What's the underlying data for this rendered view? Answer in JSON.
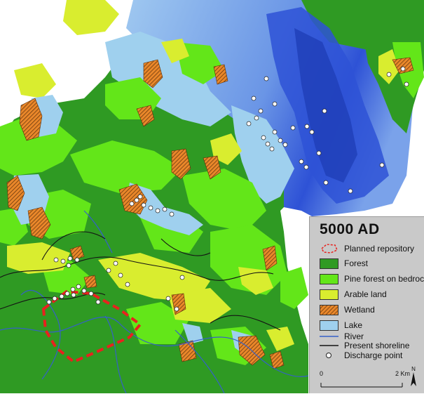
{
  "map": {
    "colors": {
      "forest": "#2f9a23",
      "pine_forest": "#63e619",
      "arable": "#d9ed2f",
      "wetland": "#e9872a",
      "lake": "#9fd0ee",
      "deep_water": "#2e52d6",
      "mid_water": "#6a95e6",
      "river": "#3560c8",
      "shoreline": "#141414",
      "repository": "#e8221e",
      "discharge_fill": "#ffffff"
    }
  },
  "legend": {
    "title": "5000 AD",
    "items": [
      {
        "label": "Planned repository",
        "symbol": "dashed-outline-icon"
      },
      {
        "label": "Forest",
        "symbol": "forest-swatch"
      },
      {
        "label": "Pine forest on bedrock",
        "symbol": "pine-forest-swatch"
      },
      {
        "label": "Arable land",
        "symbol": "arable-swatch"
      },
      {
        "label": "Wetland",
        "symbol": "wetland-hatch-swatch"
      },
      {
        "label": "Lake",
        "symbol": "lake-swatch"
      },
      {
        "label": "River",
        "symbol": "blue-line-icon"
      },
      {
        "label": "Present shoreline",
        "symbol": "black-line-icon"
      },
      {
        "label": "Discharge point",
        "symbol": "white-circle-icon"
      }
    ],
    "scale": {
      "start": "0",
      "end": "2 Km"
    },
    "north": "N"
  }
}
